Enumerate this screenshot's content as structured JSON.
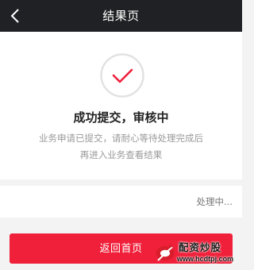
{
  "navbar": {
    "title": "结果页",
    "back_icon": "chevron-left-icon",
    "background": "#202124"
  },
  "result": {
    "icon": "check-circle-icon",
    "title": "成功提交，审核中",
    "description_line1": "业务申请已提交，请耐心等待处理完成后",
    "description_line2": "再进入业务查看结果"
  },
  "status": {
    "text": "处理中..."
  },
  "footer": {
    "home_button_label": "返回首页",
    "accent_color": "#f0203a"
  },
  "watermark": {
    "title": "配资炒股",
    "url": "www.hcdtpj.com"
  }
}
